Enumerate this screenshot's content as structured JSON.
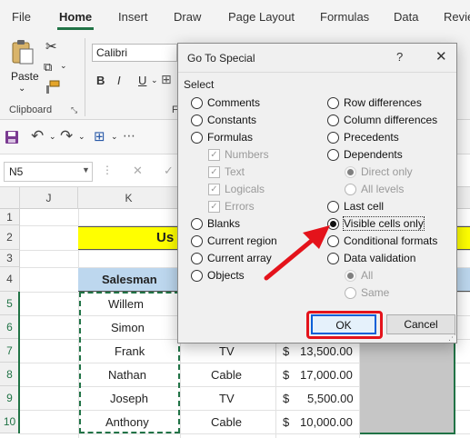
{
  "ribbon": {
    "tabs": [
      "File",
      "Home",
      "Insert",
      "Draw",
      "Page Layout",
      "Formulas",
      "Data",
      "Revie"
    ],
    "paste_label": "Paste",
    "clipboard_label": "Clipboard",
    "font_name": "Calibri",
    "font_group_partial": "F",
    "bold": "B",
    "italic": "I",
    "underline": "U"
  },
  "formula_bar": {
    "name_box": "N5",
    "cancel": "✕",
    "enter": "✓"
  },
  "grid": {
    "columns": [
      "J",
      "K"
    ],
    "rows": [
      "1",
      "2",
      "3",
      "4",
      "5",
      "6",
      "7",
      "8",
      "9",
      "10"
    ],
    "title_partial": "Us",
    "header_salesman": "Salesman",
    "salesman": [
      "Willem",
      "Simon",
      "Frank",
      "Nathan",
      "Joseph",
      "Anthony"
    ],
    "product": [
      "TV",
      "Cable",
      "TV",
      "Cable"
    ],
    "currency": "$",
    "amounts": [
      "13,500.00",
      "17,000.00",
      "5,500.00",
      "10,000.00"
    ]
  },
  "dialog": {
    "title": "Go To Special",
    "help": "?",
    "close": "✕",
    "select_label": "Select",
    "left_options": [
      "Comments",
      "Constants",
      "Formulas"
    ],
    "formula_sub": [
      "Numbers",
      "Text",
      "Logicals",
      "Errors"
    ],
    "left_options2": [
      "Blanks",
      "Current region",
      "Current array",
      "Objects"
    ],
    "right_options": [
      "Row differences",
      "Column differences",
      "Precedents",
      "Dependents"
    ],
    "dependents_sub": [
      "Direct only",
      "All levels"
    ],
    "right_options2": [
      "Last cell",
      "Visible cells only",
      "Conditional formats",
      "Data validation"
    ],
    "validation_sub": [
      "All",
      "Same"
    ],
    "ok": "OK",
    "cancel": "Cancel",
    "selected": "Visible cells only"
  },
  "colors": {
    "excel_green": "#217346",
    "title_fill": "#ffff00",
    "header_fill": "#bdd7ee",
    "selection": "#c6c6c6",
    "annotation_red": "#e4131b"
  }
}
